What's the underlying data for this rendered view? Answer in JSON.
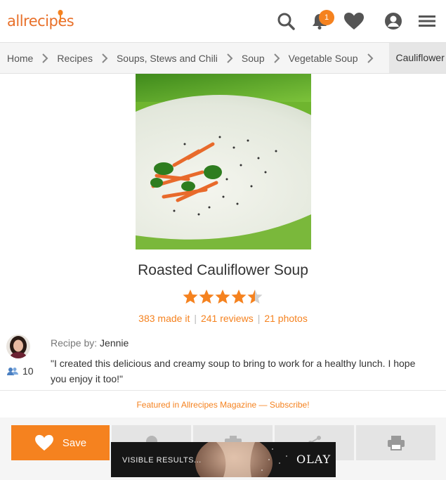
{
  "header": {
    "logo_text": "allrecipes",
    "notification_count": "1",
    "accent_color": "#f5821f"
  },
  "breadcrumb": {
    "items": [
      "Home",
      "Recipes",
      "Soups, Stews and Chili",
      "Soup",
      "Vegetable Soup"
    ],
    "current": "Cauliflower"
  },
  "recipe": {
    "title": "Roasted Cauliflower Soup",
    "rating": 4.5,
    "made_it": "383 made it",
    "reviews": "241 reviews",
    "photos": "21 photos",
    "author_prefix": "Recipe by:",
    "author_name": "Jennie",
    "author_followers": "10",
    "description": "\"I created this delicious and creamy soup to bring to work for a healthy lunch. I hope you enjoy it too!\"",
    "featured": "Featured in Allrecipes Magazine — Subscribe!"
  },
  "actions": {
    "save_label": "Save"
  },
  "ad": {
    "tagline": "VISIBLE RESULTS...",
    "brand": "OLAY"
  }
}
